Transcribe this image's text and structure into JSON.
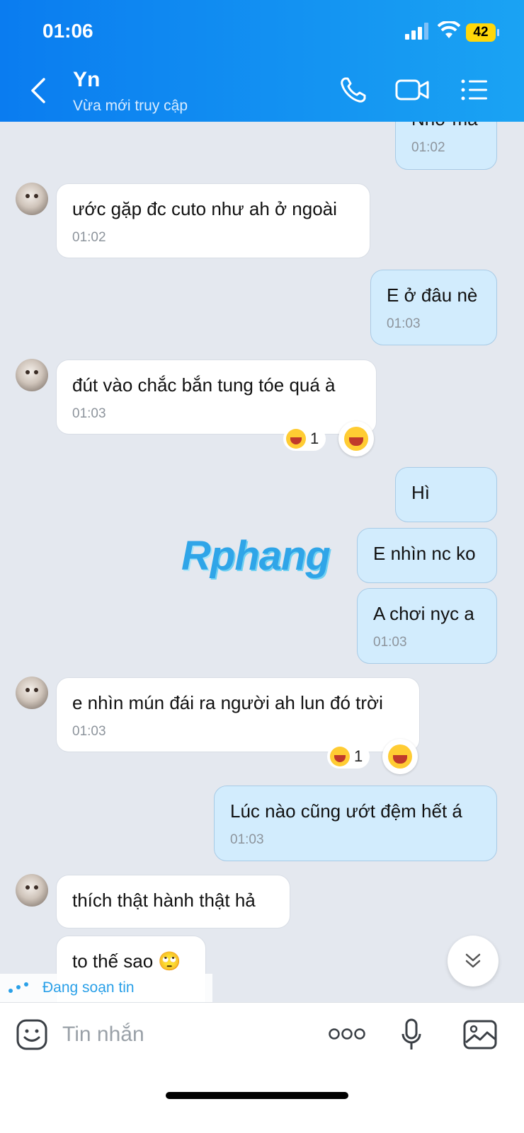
{
  "status_bar": {
    "time": "01:06",
    "battery": "42"
  },
  "header": {
    "title": "Yn",
    "subtitle": "Vừa mới truy cập"
  },
  "messages": [
    {
      "text": "Nhớ mà",
      "time": "01:02"
    },
    {
      "text": "ước gặp đc cuto như ah ở ngoài",
      "time": "01:02"
    },
    {
      "text": "E ở đâu nè",
      "time": "01:03"
    },
    {
      "text": "đút vào chắc bắn tung tóe quá à",
      "time": "01:03",
      "reaction_count": "1"
    },
    {
      "text": "Hì"
    },
    {
      "text": "E nhìn nc ko"
    },
    {
      "text": "A chơi nyc a",
      "time": "01:03"
    },
    {
      "text": "e nhìn mún đái ra người ah lun đó trời",
      "time": "01:03",
      "reaction_count": "1"
    },
    {
      "text": "Lúc nào cũng ướt đệm hết á",
      "time": "01:03"
    },
    {
      "text": "thích thật hành thật hả"
    },
    {
      "text": "to thế sao 🙄"
    }
  ],
  "watermark": {
    "part1": "R",
    "part2": "phang"
  },
  "typing_indicator": "Đang soạn tin",
  "composer": {
    "placeholder": "Tin nhắn"
  },
  "icons": [
    "back-icon",
    "phone-icon",
    "video-call-icon",
    "menu-list-icon",
    "sticker-icon",
    "more-icon",
    "microphone-icon",
    "image-icon",
    "chevron-double-down-icon",
    "laugh-emoji-icon"
  ]
}
